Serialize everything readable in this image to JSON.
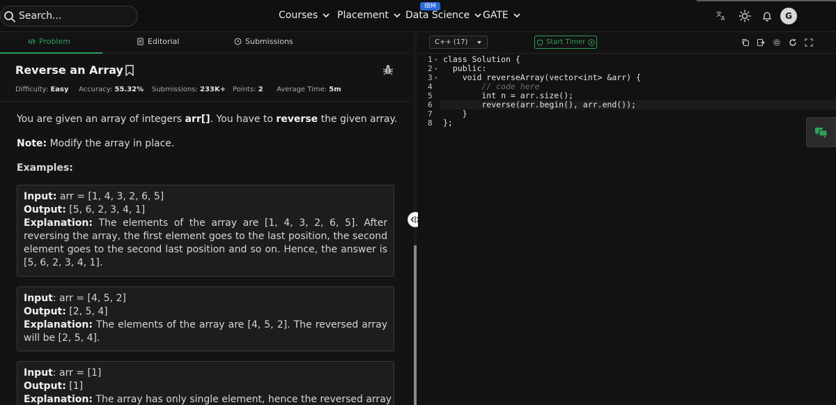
{
  "header": {
    "search_placeholder": "Search...",
    "nav": [
      {
        "label": "Courses"
      },
      {
        "label": "Placement"
      },
      {
        "label": "Data Science",
        "badge": "IBM"
      },
      {
        "label": "GATE"
      }
    ],
    "avatar_initial": "G",
    "icons": [
      "translate-icon",
      "theme-sun-icon",
      "notification-bell-icon"
    ]
  },
  "tabs": [
    {
      "label": "Problem",
      "icon": "code-icon",
      "active": true
    },
    {
      "label": "Editorial",
      "icon": "document-icon",
      "active": false
    },
    {
      "label": "Submissions",
      "icon": "clock-icon",
      "active": false
    }
  ],
  "problem": {
    "title": "Reverse an Array",
    "meta": {
      "difficulty_label": "Difficulty:",
      "difficulty": "Easy",
      "accuracy_label": "Accuracy:",
      "accuracy": "55.32%",
      "submissions_label": "Submissions:",
      "submissions": "233K+",
      "points_label": "Points:",
      "points": "2",
      "avg_time_label": "Average Time:",
      "avg_time": "5m"
    },
    "desc_prefix": "You are given an array of integers ",
    "desc_arr": "arr[]",
    "desc_mid": ". You have to ",
    "desc_reverse": "reverse",
    "desc_suffix": " the given array.",
    "note_label": "Note:",
    "note_text": " Modify the array in place.",
    "examples_heading": "Examples:",
    "input_label": "Input:",
    "input_label_plain": "Input",
    "output_label": "Output:",
    "explanation_label": "Explanation:",
    "examples": [
      {
        "input": " arr = [1, 4, 3, 2, 6, 5]",
        "output": " [5, 6, 2, 3, 4, 1]",
        "explanation": " The elements of the array are [1, 4, 3, 2, 6, 5]. After reversing the array, the first element goes to the last position, the second element goes to the second last position and so on. Hence, the answer is [5, 6, 2, 3, 4, 1]."
      },
      {
        "input": ": arr = [4, 5, 2]",
        "output": " [2, 5, 4]",
        "explanation": " The elements of the array are [4, 5, 2]. The reversed array will be [2, 5, 4]."
      },
      {
        "input": ": arr = [1]",
        "output": " [1]",
        "explanation": " The array has only single element, hence the reversed array is"
      }
    ]
  },
  "editor": {
    "language": "C++ (17)",
    "timer_label": "Start Timer",
    "code_lines": [
      "class Solution {",
      "  public:",
      "    void reverseArray(vector<int> &arr) {",
      "        // code here",
      "        int n = arr.size();",
      "        reverse(arr.begin(), arr.end());",
      "    }",
      "};"
    ],
    "line_numbers": [
      "1",
      "2",
      "3",
      "4",
      "5",
      "6",
      "7",
      "8"
    ]
  },
  "colors": {
    "accent_green": "#2f9e5b",
    "background": "#131313",
    "ibm_badge": "#2a6ad8"
  }
}
